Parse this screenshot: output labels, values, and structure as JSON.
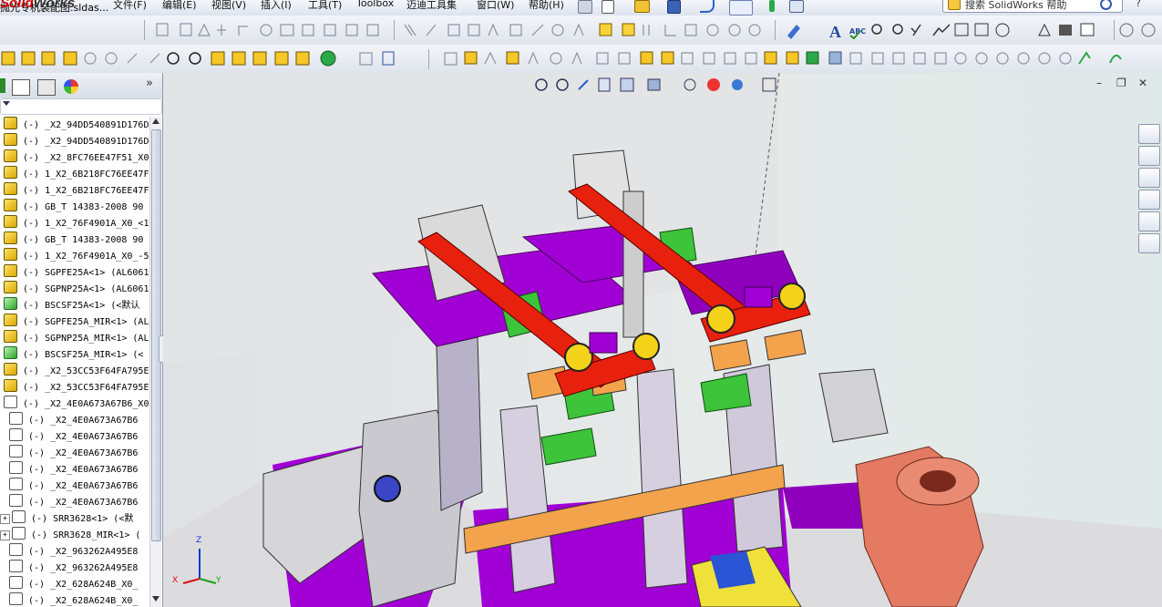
{
  "app": {
    "logo_left": "Solid",
    "logo_right": "Works"
  },
  "menu": [
    "文件(F)",
    "编辑(E)",
    "视图(V)",
    "插入(I)",
    "工具(T)",
    "Toolbox",
    "迈迪工具集",
    "窗口(W)",
    "帮助(H)"
  ],
  "document_title": "抛光专机装配图.sldas...",
  "search": {
    "placeholder": "搜索 SolidWorks 帮助"
  },
  "help_glyph": "?",
  "tree": {
    "rows": [
      {
        "label": "(-) _X2_94DD540891D176D",
        "icon": "part-icon",
        "indent": 0
      },
      {
        "label": "(-) _X2_94DD540891D176D",
        "icon": "part-icon",
        "indent": 0
      },
      {
        "label": "(-) _X2_8FC76EE47F51_X0",
        "icon": "part-icon",
        "indent": 0
      },
      {
        "label": "(-) 1_X2_6B218FC76EE47F",
        "icon": "part-icon",
        "indent": 0
      },
      {
        "label": "(-) 1_X2_6B218FC76EE47F",
        "icon": "part-icon",
        "indent": 0
      },
      {
        "label": "(-) GB_T 14383-2008 90",
        "icon": "part-icon",
        "indent": 0
      },
      {
        "label": "(-) 1_X2_76F4901A_X0_<1",
        "icon": "part-icon",
        "indent": 0
      },
      {
        "label": "(-) GB_T 14383-2008 90",
        "icon": "part-icon",
        "indent": 0
      },
      {
        "label": "(-) 1_X2_76F4901A_X0_-5",
        "icon": "part-icon",
        "indent": 0
      },
      {
        "label": "(-) SGPFE25A<1> (AL6061",
        "icon": "part-icon",
        "indent": 0
      },
      {
        "label": "(-) SGPNP25A<1> (AL6061",
        "icon": "part-icon",
        "indent": 0
      },
      {
        "label": "(-) BSCSF25A<1> (<默认",
        "icon": "assembly-green-icon",
        "indent": 0
      },
      {
        "label": "(-) SGPFE25A_MIR<1> (AL",
        "icon": "part-icon",
        "indent": 0
      },
      {
        "label": "(-) SGPNP25A_MIR<1> (AL",
        "icon": "part-icon",
        "indent": 0
      },
      {
        "label": "(-) BSCSF25A_MIR<1> (<",
        "icon": "assembly-green-icon",
        "indent": 0
      },
      {
        "label": "(-) _X2_53CC53F64FA795E",
        "icon": "part-icon",
        "indent": 0
      },
      {
        "label": "(-) _X2_53CC53F64FA795E",
        "icon": "part-icon",
        "indent": 0
      },
      {
        "label": "(-) _X2_4E0A673A67B6_X0",
        "icon": "subassembly-icon",
        "indent": 0
      },
      {
        "label": "(-) _X2_4E0A673A67B6",
        "icon": "subassembly-icon",
        "indent": 1
      },
      {
        "label": "(-) _X2_4E0A673A67B6",
        "icon": "subassembly-icon",
        "indent": 1
      },
      {
        "label": "(-) _X2_4E0A673A67B6",
        "icon": "subassembly-icon",
        "indent": 1
      },
      {
        "label": "(-) _X2_4E0A673A67B6",
        "icon": "subassembly-icon",
        "indent": 1
      },
      {
        "label": "(-) _X2_4E0A673A67B6",
        "icon": "subassembly-icon",
        "indent": 1
      },
      {
        "label": "(-) _X2_4E0A673A67B6",
        "icon": "subassembly-icon",
        "indent": 1
      },
      {
        "label": "(-) SRR3628<1> (<默",
        "icon": "subassembly-icon",
        "indent": 1,
        "expand": "+"
      },
      {
        "label": "(-) SRR3628_MIR<1> (",
        "icon": "subassembly-icon",
        "indent": 1,
        "expand": "+"
      },
      {
        "label": "(-) _X2_963262A495E8",
        "icon": "subassembly-icon",
        "indent": 1
      },
      {
        "label": "(-) _X2_963262A495E8",
        "icon": "subassembly-icon",
        "indent": 1
      },
      {
        "label": "(-) _X2_628A624B_X0_",
        "icon": "subassembly-icon",
        "indent": 1
      },
      {
        "label": "(-) _X2_628A624B_X0_",
        "icon": "subassembly-icon",
        "indent": 1
      }
    ]
  },
  "viewport": {
    "triad": {
      "z": "Z",
      "x": "X",
      "y": "Y"
    }
  },
  "colors": {
    "purple": "#a100d4",
    "red": "#e8200e",
    "green": "#3dc43a",
    "orange": "#f3a34b",
    "grey": "#c9c9cf",
    "salmon": "#e57a63"
  }
}
